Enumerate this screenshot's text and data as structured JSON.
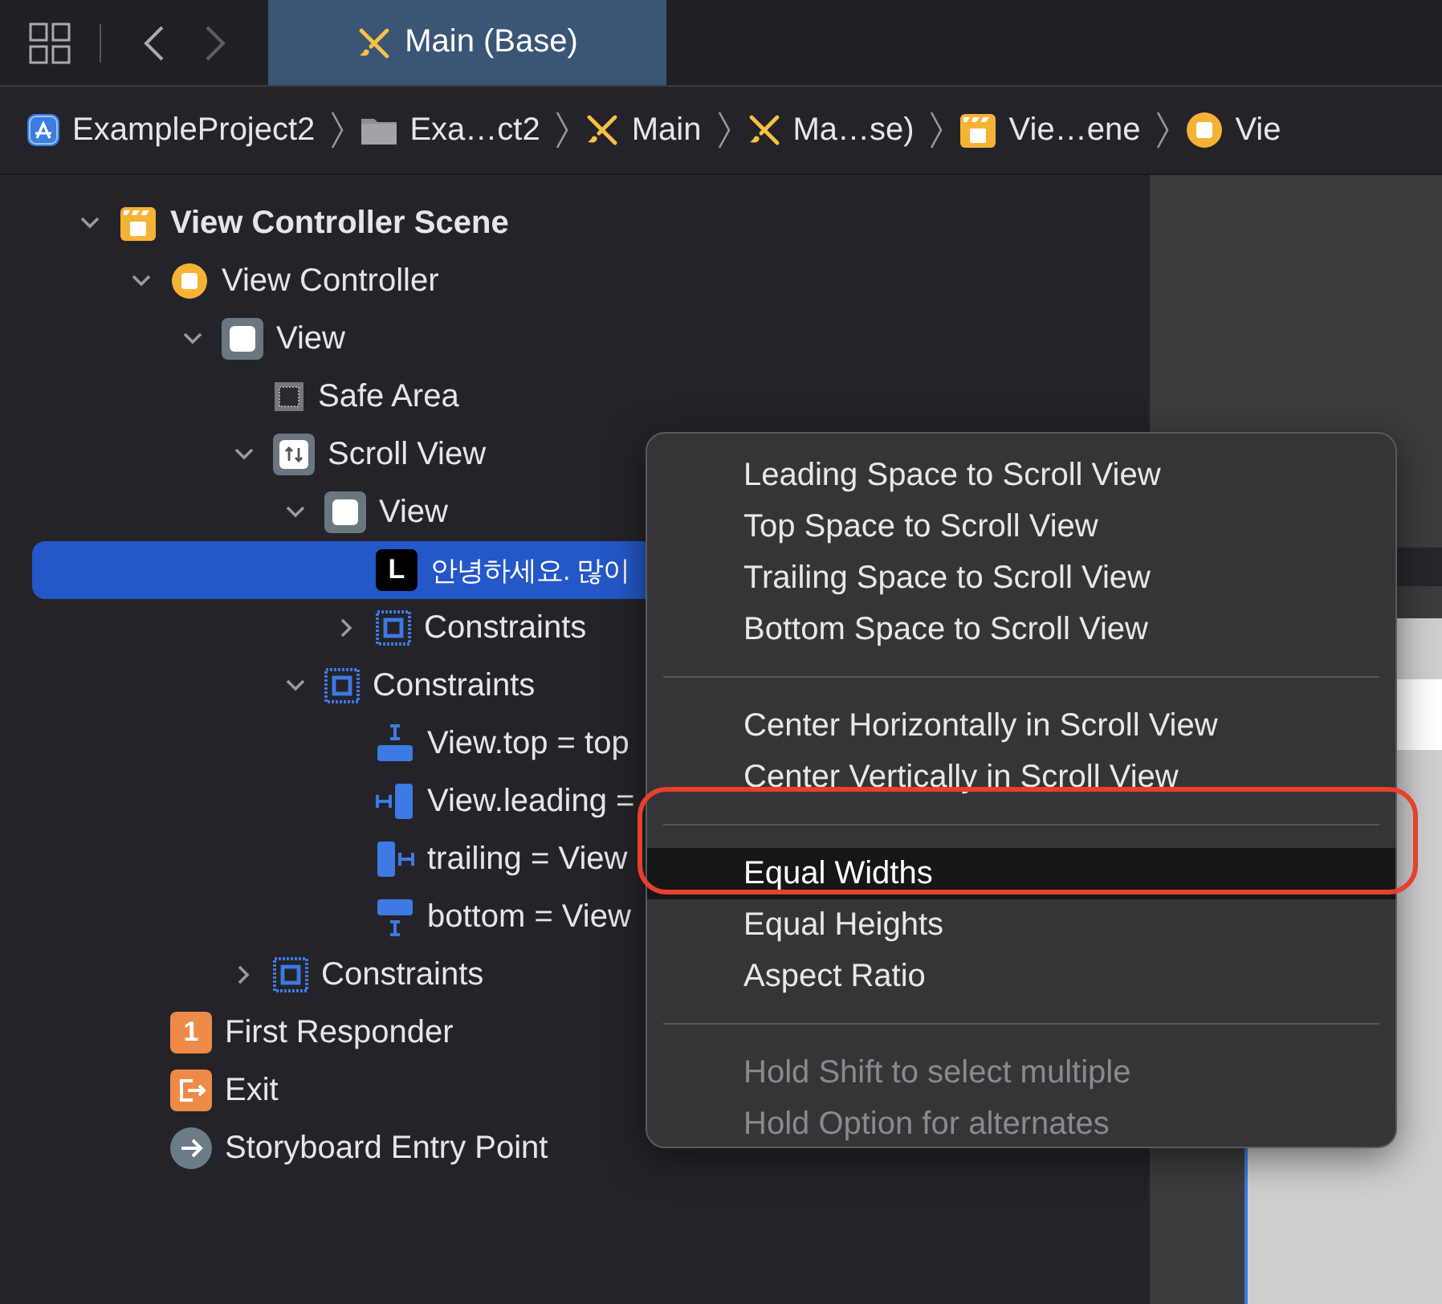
{
  "toolbar": {
    "back_disabled": false,
    "forward_disabled": true
  },
  "tabs": [
    {
      "label": "Main (Base)",
      "kind": "storyboard",
      "selected": true
    }
  ],
  "breadcrumb": [
    {
      "label": "ExampleProject2",
      "kind": "app"
    },
    {
      "label": "Exa…ct2",
      "kind": "folder"
    },
    {
      "label": "Main",
      "kind": "storyboard"
    },
    {
      "label": "Ma…se)",
      "kind": "storyboard"
    },
    {
      "label": "Vie…ene",
      "kind": "scene"
    },
    {
      "label": "Vie",
      "kind": "controller"
    }
  ],
  "outline": [
    {
      "label": "View Controller Scene",
      "kind": "scene",
      "expanded": true,
      "selected": false,
      "children": [
        {
          "label": "View Controller",
          "kind": "controller",
          "expanded": true,
          "selected": false,
          "children": [
            {
              "label": "View",
              "kind": "view",
              "expanded": true,
              "selected": false,
              "children": [
                {
                  "label": "Safe Area",
                  "kind": "safearea",
                  "selected": false
                },
                {
                  "label": "Scroll View",
                  "kind": "scrollview",
                  "expanded": true,
                  "selected": false,
                  "children": [
                    {
                      "label": "View",
                      "kind": "view",
                      "expanded": true,
                      "selected": false,
                      "children": [
                        {
                          "label": "안녕하세요. 많이",
                          "kind": "label",
                          "badge": "L",
                          "selected": true
                        },
                        {
                          "label": "Constraints",
                          "kind": "constraints",
                          "expanded": false,
                          "selected": false
                        }
                      ]
                    },
                    {
                      "label": "Constraints",
                      "kind": "constraints",
                      "expanded": true,
                      "selected": false,
                      "children": [
                        {
                          "label": "View.top = top",
                          "kind": "constraint-top",
                          "selected": false
                        },
                        {
                          "label": "View.leading =",
                          "kind": "constraint-leading",
                          "selected": false
                        },
                        {
                          "label": "trailing = View",
                          "kind": "constraint-trailing",
                          "selected": false
                        },
                        {
                          "label": "bottom = View",
                          "kind": "constraint-bottom",
                          "selected": false
                        }
                      ]
                    }
                  ]
                },
                {
                  "label": "Constraints",
                  "kind": "constraints",
                  "expanded": false,
                  "selected": false
                }
              ]
            }
          ]
        },
        {
          "label": "First Responder",
          "kind": "responder",
          "badge": "1",
          "selected": false
        },
        {
          "label": "Exit",
          "kind": "exit",
          "selected": false
        },
        {
          "label": "Storyboard Entry Point",
          "kind": "entry",
          "selected": false
        }
      ]
    }
  ],
  "menu": {
    "sections": [
      [
        {
          "label": "Leading Space to Scroll View",
          "selected": false,
          "disabled": false
        },
        {
          "label": "Top Space to Scroll View",
          "selected": false,
          "disabled": false
        },
        {
          "label": "Trailing Space to Scroll View",
          "selected": false,
          "disabled": false
        },
        {
          "label": "Bottom Space to Scroll View",
          "selected": false,
          "disabled": false
        }
      ],
      [
        {
          "label": "Center Horizontally in Scroll View",
          "selected": false,
          "disabled": false
        },
        {
          "label": "Center Vertically in Scroll View",
          "selected": false,
          "disabled": false
        }
      ],
      [
        {
          "label": "Equal Widths",
          "selected": true,
          "disabled": false
        },
        {
          "label": "Equal Heights",
          "selected": false,
          "disabled": false
        },
        {
          "label": "Aspect Ratio",
          "selected": false,
          "disabled": false
        }
      ],
      [
        {
          "label": "Hold Shift to select multiple",
          "selected": false,
          "disabled": true
        },
        {
          "label": "Hold Option for alternates",
          "selected": false,
          "disabled": true
        }
      ]
    ]
  }
}
